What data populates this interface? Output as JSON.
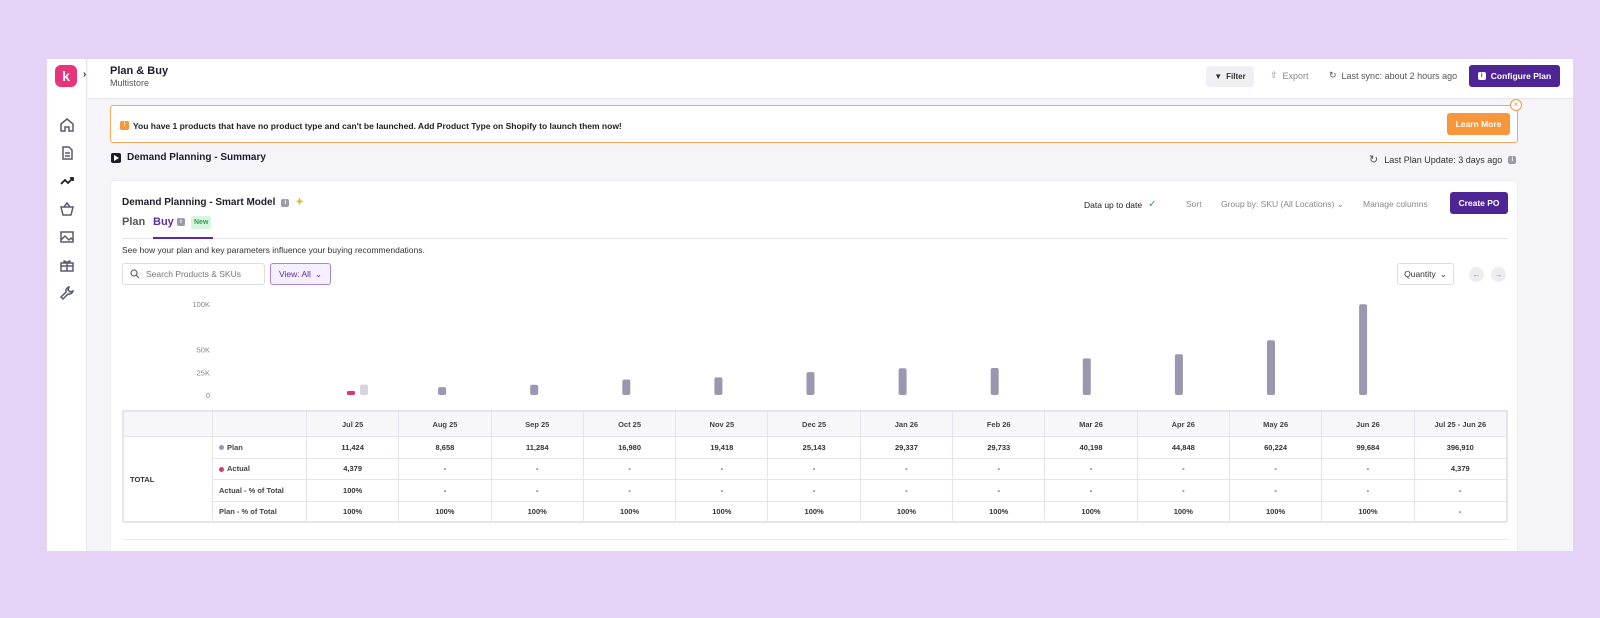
{
  "app": {
    "logo_letter": "k",
    "title": "Plan & Buy",
    "subtitle": "Multistore"
  },
  "topbar": {
    "filter_label": "Filter",
    "export_label": "Export",
    "sync_label": "Last sync: about 2 hours ago",
    "configure_label": "Configure Plan"
  },
  "banner": {
    "message": "You have 1 products that have no product type and can't be launched. Add Product Type on Shopify to launch them now!",
    "button_label": "Learn More",
    "warn_glyph": "!"
  },
  "section": {
    "title": "Demand Planning - Summary",
    "last_update": "Last Plan Update: 3 days ago"
  },
  "card": {
    "title": "Demand Planning - Smart Model",
    "tabs": [
      {
        "label": "Plan"
      },
      {
        "label": "Buy"
      }
    ],
    "new_badge": "New",
    "status": "Data up to date",
    "sort_label": "Sort",
    "groupby_label": "Group by: SKU (All Locations)",
    "manage_label": "Manage columns",
    "create_po_label": "Create PO",
    "description": "See how your plan and key parameters influence your buying recommendations.",
    "search_placeholder": "Search Products & SKUs",
    "view_label": "View: All",
    "quantity_label": "Quantity"
  },
  "colors": {
    "primary": "#4f2494",
    "accent": "#f7963a",
    "plan_bar": "#9b97b1",
    "actual_bar": "#e0337a"
  },
  "chart_data": {
    "type": "bar",
    "y_ticks": [
      "100K",
      "50K",
      "25K",
      "0"
    ],
    "y_tick_values": [
      100000,
      50000,
      25000,
      0
    ],
    "ylim": [
      0,
      100000
    ],
    "categories": [
      "Jul 25",
      "Aug 25",
      "Sep 25",
      "Oct 25",
      "Nov 25",
      "Dec 25",
      "Jan 26",
      "Feb 26",
      "Mar 26",
      "Apr 26",
      "May 26",
      "Jun 26"
    ],
    "series": [
      {
        "name": "Plan",
        "values": [
          11424,
          8658,
          11284,
          16980,
          19418,
          25143,
          29337,
          29733,
          40198,
          44848,
          60224,
          99684
        ]
      },
      {
        "name": "Actual",
        "values": [
          4379,
          null,
          null,
          null,
          null,
          null,
          null,
          null,
          null,
          null,
          null,
          null
        ]
      }
    ]
  },
  "table": {
    "header_months": [
      "Jul 25",
      "Aug 25",
      "Sep 25",
      "Oct 25",
      "Nov 25",
      "Dec 25",
      "Jan 26",
      "Feb 26",
      "Mar 26",
      "Apr 26",
      "May 26",
      "Jun 26",
      "Jul 25 - Jun 26"
    ],
    "group_label": "TOTAL",
    "rows": [
      {
        "label": "Plan",
        "values": [
          "11,424",
          "8,658",
          "11,284",
          "16,980",
          "19,418",
          "25,143",
          "29,337",
          "29,733",
          "40,198",
          "44,848",
          "60,224",
          "99,684",
          "396,910"
        ]
      },
      {
        "label": "Actual",
        "values": [
          "4,379",
          "-",
          "-",
          "-",
          "-",
          "-",
          "-",
          "-",
          "-",
          "-",
          "-",
          "-",
          "4,379"
        ]
      },
      {
        "label": "Actual - % of Total",
        "values": [
          "100%",
          "-",
          "-",
          "-",
          "-",
          "-",
          "-",
          "-",
          "-",
          "-",
          "-",
          "-",
          "-"
        ]
      },
      {
        "label": "Plan - % of Total",
        "values": [
          "100%",
          "100%",
          "100%",
          "100%",
          "100%",
          "100%",
          "100%",
          "100%",
          "100%",
          "100%",
          "100%",
          "100%",
          "-"
        ]
      }
    ]
  }
}
